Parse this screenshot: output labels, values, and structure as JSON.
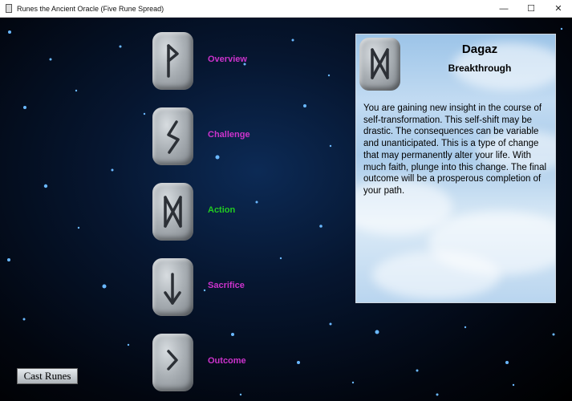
{
  "window": {
    "title": "Runes the Ancient Oracle (Five Rune Spread)"
  },
  "spread": [
    {
      "label": "Overview",
      "rune_icon": "wunjo-rune-icon",
      "color": "#cc33cc"
    },
    {
      "label": "Challenge",
      "rune_icon": "sowilo-rune-icon",
      "color": "#cc33cc"
    },
    {
      "label": "Action",
      "rune_icon": "dagaz-rune-icon",
      "color": "#22cc22"
    },
    {
      "label": "Sacrifice",
      "rune_icon": "eihwaz-rune-icon",
      "color": "#cc33cc"
    },
    {
      "label": "Outcome",
      "rune_icon": "kenaz-rune-icon",
      "color": "#cc33cc"
    }
  ],
  "detail": {
    "rune_icon": "dagaz-rune-icon",
    "name": "Dagaz",
    "subtitle": "Breakthrough",
    "text": "You are gaining new insight in the course of self-transformation.  This self-shift may be drastic.  The consequences can be variable and unanticipated.  This is a type of change that may permanently alter your life.  With much faith, plunge into this change. The final outcome will be a prosperous completion of your path."
  },
  "cast_button": {
    "label": "Cast Runes"
  }
}
